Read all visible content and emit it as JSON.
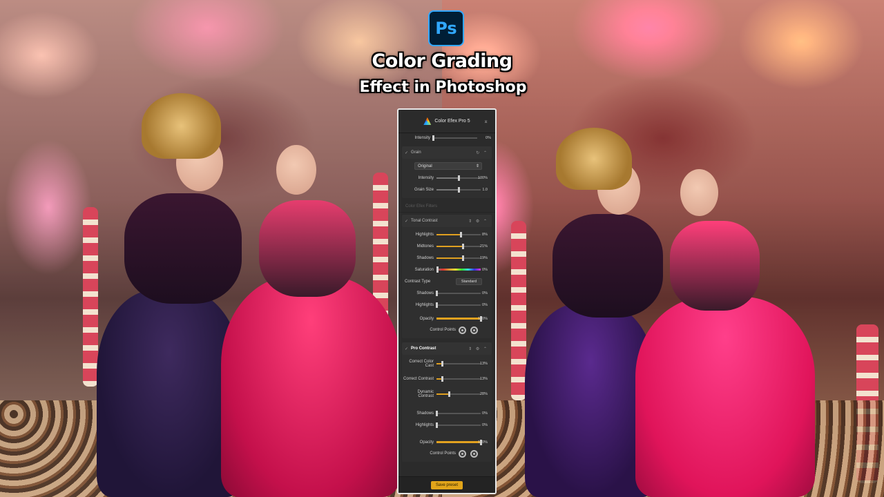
{
  "title": {
    "app_logo": "Ps",
    "line1": "Color Grading",
    "line2": "Effect in Photoshop"
  },
  "panel": {
    "header": {
      "title": "Color Efex Pro 5"
    },
    "top_rows": [
      {
        "label": "Intensity",
        "value": "0%",
        "level": 0
      }
    ],
    "grain": {
      "name": "Grain",
      "select": "Original",
      "rows": [
        {
          "label": "Intensity",
          "value": "100%",
          "level": 0.5
        },
        {
          "label": "Grain Size",
          "value": "1.0",
          "level": 0.5
        }
      ]
    },
    "filters_label": "Color Efex Filters",
    "tonal_contrast": {
      "name": "Tonal Contrast",
      "rows": [
        {
          "label": "Highlights",
          "value": "8%",
          "level": 0.54
        },
        {
          "label": "Midtones",
          "value": "21%",
          "level": 0.6
        },
        {
          "label": "Shadows",
          "value": "19%",
          "level": 0.6
        }
      ],
      "saturation": {
        "label": "Saturation",
        "value": "0%"
      },
      "contrast_type": {
        "label": "Contrast Type",
        "value": "Standard"
      },
      "rows2": [
        {
          "label": "Shadows",
          "value": "0%",
          "level": 0
        },
        {
          "label": "Highlights",
          "value": "0%",
          "level": 0
        }
      ],
      "opacity": {
        "label": "Opacity",
        "value": "100%",
        "level": 1
      },
      "control_points": {
        "label": "Control Points"
      }
    },
    "pro_contrast": {
      "name": "Pro Contrast",
      "rows": [
        {
          "label": "Correct Color Cast",
          "value": "13%",
          "level": 0.13
        },
        {
          "label": "Correct Contrast",
          "value": "13%",
          "level": 0.13
        },
        {
          "label": "Dynamic Contrast",
          "value": "28%",
          "level": 0.28
        }
      ],
      "rows2": [
        {
          "label": "Shadows",
          "value": "0%",
          "level": 0
        },
        {
          "label": "Highlights",
          "value": "0%",
          "level": 0
        }
      ],
      "opacity": {
        "label": "Opacity",
        "value": "100%",
        "level": 1
      },
      "control_points": {
        "label": "Control Points"
      }
    },
    "footer": {
      "save_label": "Save preset"
    }
  },
  "colors": {
    "accent": "#e2a51a",
    "panel_bg": "#2b2b2b",
    "ps_blue": "#31a8ff"
  }
}
